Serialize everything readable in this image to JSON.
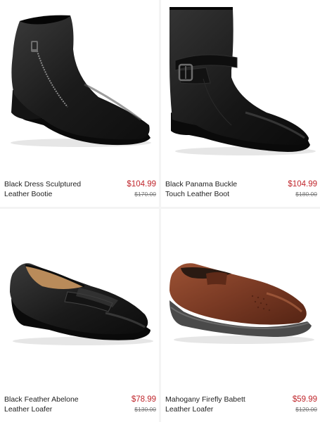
{
  "products": [
    {
      "name": "Black Dress Sculptured Leather Bootie",
      "price": "$104.99",
      "original_price": "$170.00",
      "image": "black-ankle-bootie-image"
    },
    {
      "name": "Black Panama Buckle Touch Leather Boot",
      "price": "$104.99",
      "original_price": "$180.00",
      "image": "black-buckle-boot-image"
    },
    {
      "name": "Black Feather Abelone Leather Loafer",
      "price": "$78.99",
      "original_price": "$130.00",
      "image": "black-loafer-image"
    },
    {
      "name": "Mahogany Firefly Babett Leather Loafer",
      "price": "$59.99",
      "original_price": "$120.00",
      "image": "brown-slip-on-image"
    }
  ],
  "colors": {
    "sale_price": "#c0262c",
    "original_price": "#777777",
    "black_leather": "#1c1c1c",
    "mahogany_leather": "#7a3a24",
    "sole_gray": "#4a4a4a"
  }
}
